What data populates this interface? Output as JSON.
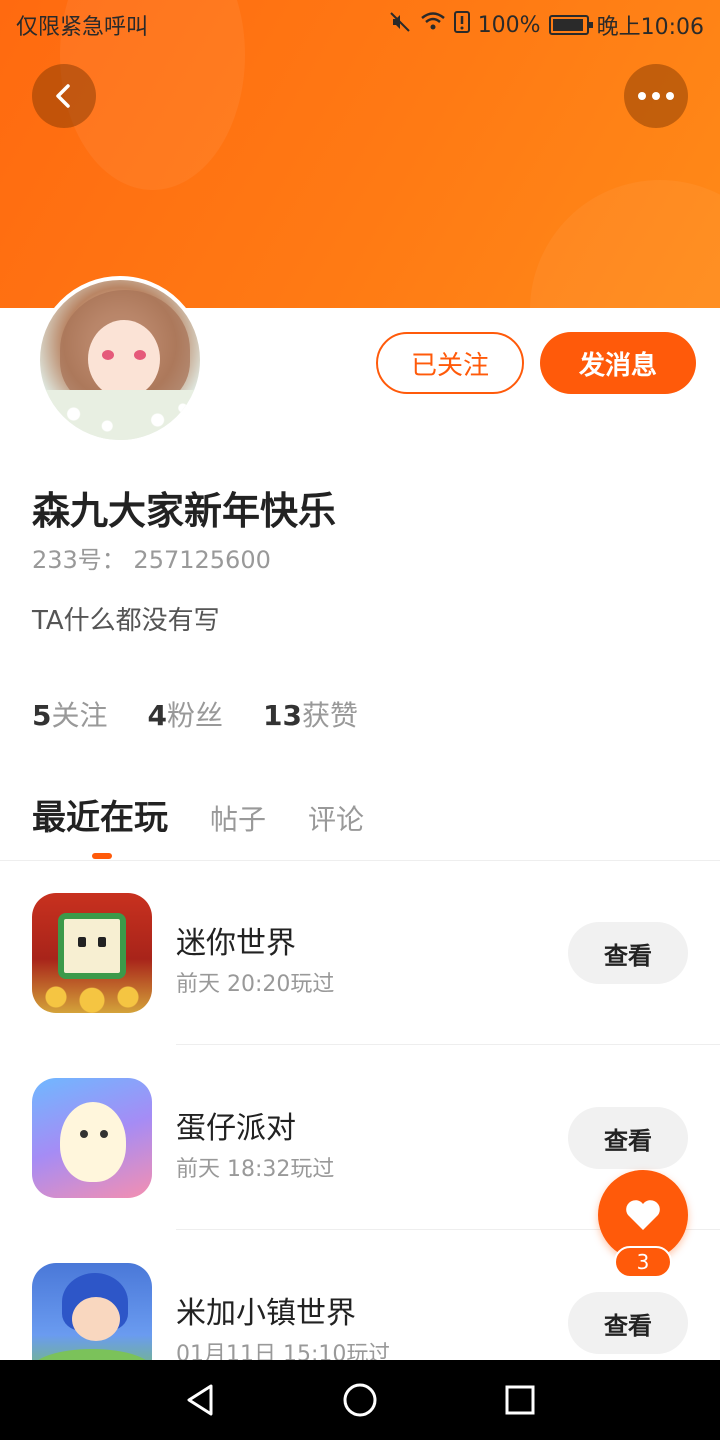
{
  "status_bar": {
    "left_text": "仅限紧急呼叫",
    "battery_text": "100%",
    "time": "晚上10:06"
  },
  "profile": {
    "name": "森九大家新年快乐",
    "id_text": "233号： 257125600",
    "bio": "TA什么都没有写",
    "follow_label": "已关注",
    "message_label": "发消息"
  },
  "stats": [
    {
      "num": "5",
      "label": "关注"
    },
    {
      "num": "4",
      "label": "粉丝"
    },
    {
      "num": "13",
      "label": "获赞"
    }
  ],
  "tabs": [
    {
      "label": "最近在玩",
      "active": true
    },
    {
      "label": "帖子",
      "active": false
    },
    {
      "label": "评论",
      "active": false
    }
  ],
  "games": [
    {
      "title": "迷你世界",
      "played": "前天 20:20玩过",
      "action": "查看"
    },
    {
      "title": "蛋仔派对",
      "played": "前天 18:32玩过",
      "action": "查看"
    },
    {
      "title": "米加小镇世界",
      "played": "01月11日 15:10玩过",
      "action": "查看"
    }
  ],
  "like": {
    "count": "3"
  },
  "colors": {
    "accent": "#ff5a0a",
    "banner": "#ff7a14"
  }
}
